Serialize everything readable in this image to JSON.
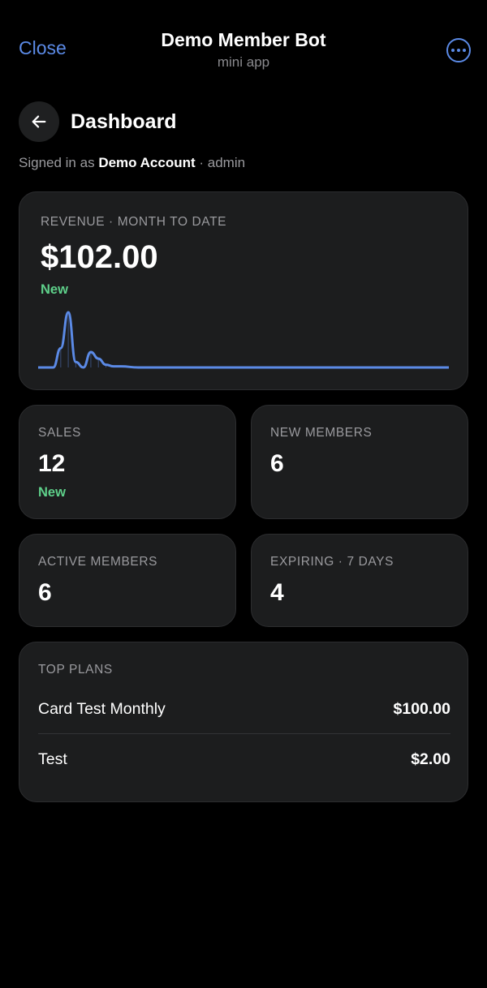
{
  "topbar": {
    "close_label": "Close",
    "title": "Demo Member Bot",
    "subtitle": "mini app"
  },
  "header": {
    "title": "Dashboard"
  },
  "signed_in": {
    "prefix": "Signed in as",
    "account": "Demo Account",
    "role": "· admin"
  },
  "revenue": {
    "label": "REVENUE · MONTH TO DATE",
    "value": "$102.00",
    "badge": "New",
    "spark": [
      0,
      0,
      0,
      0.35,
      1,
      0.1,
      0,
      0.28,
      0.16,
      0.05,
      0.02,
      0.02,
      0,
      0,
      0,
      0,
      0,
      0,
      0,
      0,
      0,
      0,
      0,
      0,
      0,
      0,
      0,
      0,
      0,
      0,
      0
    ],
    "line_color": "#5b8ae6"
  },
  "stats": {
    "sales": {
      "label": "SALES",
      "value": "12",
      "badge": "New"
    },
    "new_members": {
      "label": "NEW MEMBERS",
      "value": "6"
    },
    "active_members": {
      "label": "ACTIVE MEMBERS",
      "value": "6"
    },
    "expiring": {
      "label": "EXPIRING · 7 DAYS",
      "value": "4"
    }
  },
  "top_plans": {
    "label": "TOP PLANS",
    "items": [
      {
        "name": "Card Test Monthly",
        "price": "$100.00"
      },
      {
        "name": "Test",
        "price": "$2.00"
      }
    ]
  },
  "colors": {
    "accent": "#5b8ae6",
    "positive": "#5ed08a",
    "card_bg": "#1c1d1e",
    "page_bg": "#000000"
  }
}
